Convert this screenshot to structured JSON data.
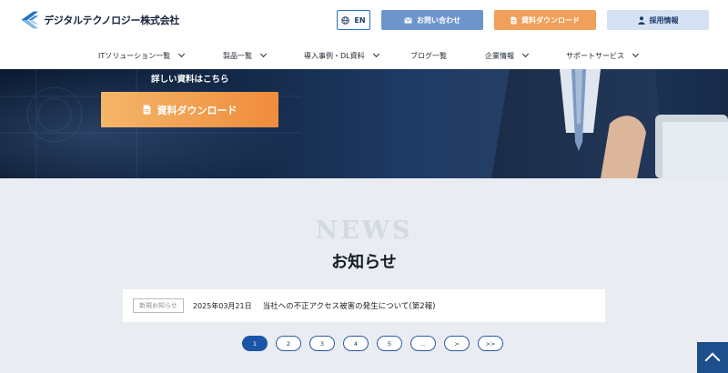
{
  "company": {
    "name": "デジタルテクノロジー株式会社"
  },
  "header": {
    "lang_label": "EN",
    "contact_label": "お問い合わせ",
    "download_label": "資料ダウンロード",
    "recruit_label": "採用情報"
  },
  "nav": {
    "items": [
      {
        "label": "ITソリューション一覧"
      },
      {
        "label": "製品一覧"
      },
      {
        "label": "導入事例・DL資料"
      },
      {
        "label": "ブログ一覧"
      },
      {
        "label": "企業情報"
      },
      {
        "label": "サポートサービス"
      }
    ]
  },
  "hero": {
    "subtitle": "詳しい資料はこちら",
    "cta_label": "資料ダウンロード"
  },
  "news": {
    "heading_en": "NEWS",
    "heading_ja": "お知らせ",
    "items": [
      {
        "tag": "新規お知らせ",
        "date": "2025年03月21日",
        "title": "当社への不正アクセス被害の発生について(第2報)"
      }
    ]
  },
  "pagination": {
    "pages": [
      "1",
      "2",
      "3",
      "4",
      "5",
      "…",
      ">",
      ">>"
    ],
    "current": "1"
  },
  "colors": {
    "accent_blue": "#1a55a8",
    "accent_orange": "#f08c3c",
    "contact_blue": "#6e95cb"
  }
}
